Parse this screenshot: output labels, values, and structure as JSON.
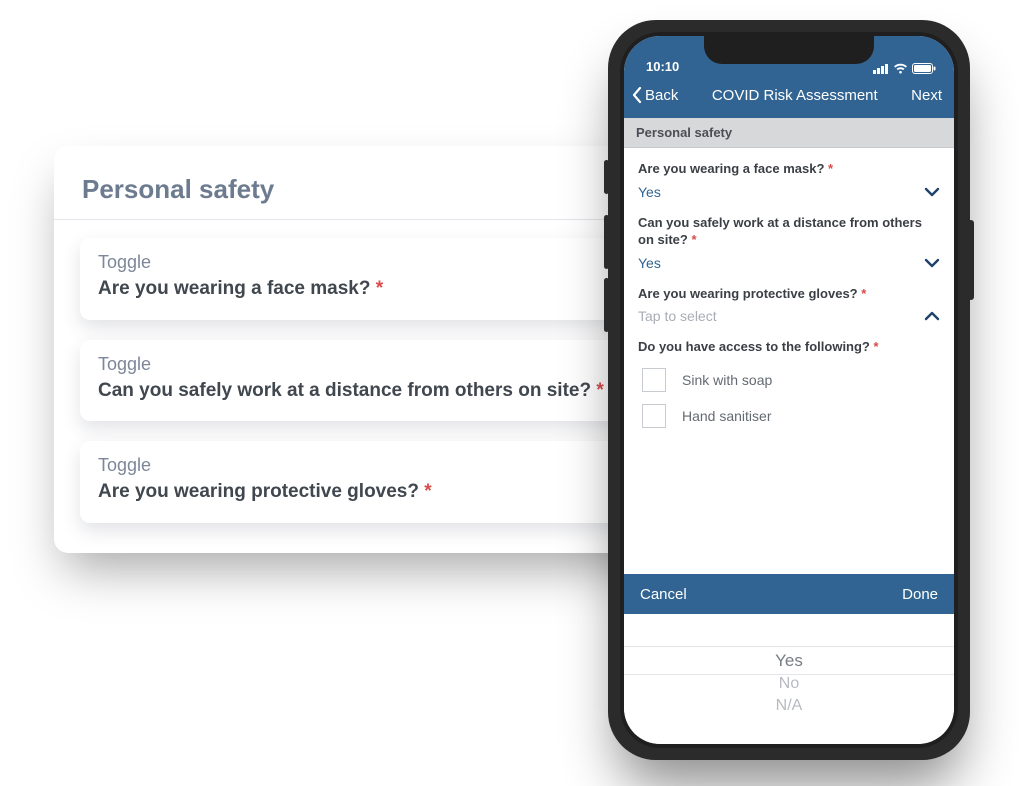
{
  "builder": {
    "section_title": "Personal safety",
    "fields": [
      {
        "type_label": "Toggle",
        "question": "Are you wearing a face mask?",
        "required_marker": "*"
      },
      {
        "type_label": "Toggle",
        "question": "Can you safely work at a distance from others on site?",
        "required_marker": "*"
      },
      {
        "type_label": "Toggle",
        "question": "Are you wearing protective gloves?",
        "required_marker": "*"
      }
    ]
  },
  "phone": {
    "status": {
      "time": "10:10"
    },
    "nav": {
      "back": "Back",
      "title": "COVID Risk Assessment",
      "next": "Next"
    },
    "section_header": "Personal safety",
    "questions": {
      "q1": {
        "label": "Are you wearing a face mask?",
        "req": "*",
        "value": "Yes"
      },
      "q2": {
        "label": "Can you safely work at a distance from others on site?",
        "req": "*",
        "value": "Yes"
      },
      "q3": {
        "label": "Are you wearing protective gloves?",
        "req": "*",
        "placeholder": "Tap to select"
      },
      "q4": {
        "label": "Do you have access to the following?",
        "req": "*",
        "options": [
          "Sink with soap",
          "Hand sanitiser"
        ]
      }
    },
    "picker": {
      "cancel": "Cancel",
      "done": "Done",
      "options": [
        "Yes",
        "No",
        "N/A"
      ]
    }
  }
}
